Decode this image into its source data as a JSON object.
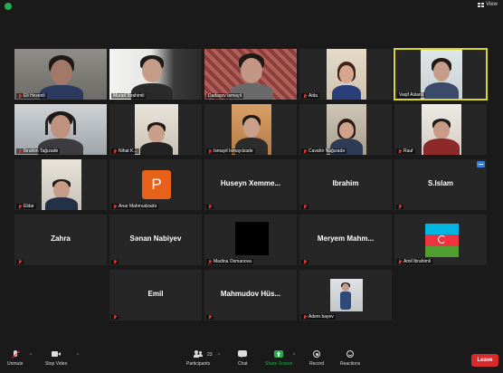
{
  "topbar": {
    "view_label": "View"
  },
  "tiles": [
    {
      "name": "Eli Hasanli",
      "label": "Eli Hesenli",
      "muted": true,
      "kind": "video"
    },
    {
      "name": "Murad Ibrahimli",
      "label": "Murad İbrahimli",
      "muted": false,
      "kind": "video"
    },
    {
      "name": "Dadashov Ismayil",
      "label": "Dadaşov İsmayıl",
      "muted": false,
      "kind": "video"
    },
    {
      "name": "Aida",
      "label": "Aida",
      "muted": true,
      "kind": "video"
    },
    {
      "name": "Vaqif Aslanli",
      "label": "Vaqif Aslanlı",
      "muted": false,
      "kind": "video",
      "active": true
    },
    {
      "name": "Ibrahim Tagizade",
      "label": "İbrahim Tağızade",
      "muted": true,
      "kind": "video"
    },
    {
      "name": "Nihat K",
      "label": "Nihat K...",
      "muted": true,
      "kind": "video"
    },
    {
      "name": "Ismayil Ismayilzade",
      "label": "İsmayil İsmayılzade",
      "muted": true,
      "kind": "video"
    },
    {
      "name": "Cavahir Nagizade",
      "label": "Cavahir Nağızadə",
      "muted": true,
      "kind": "video"
    },
    {
      "name": "Rauf",
      "label": "Rauf",
      "muted": true,
      "kind": "video"
    },
    {
      "name": "Eldar",
      "label": "Eldar",
      "muted": true,
      "kind": "video"
    },
    {
      "name": "Anar Mahmudzada",
      "label": "Anar Mahmudzadə",
      "muted": true,
      "kind": "avatar",
      "initial": "P"
    },
    {
      "name": "Huseyn Xemme",
      "label": "Huseyn   Xemme...",
      "muted": true,
      "kind": "text"
    },
    {
      "name": "Ibrahim",
      "label": "Ibrahim",
      "muted": true,
      "kind": "text"
    },
    {
      "name": "S.Islam",
      "label": "S.Islam",
      "muted": true,
      "kind": "text"
    },
    {
      "name": "Zahra",
      "label": "Zahra",
      "muted": true,
      "kind": "text"
    },
    {
      "name": "Sanan Nabiyev",
      "label": "Sənan Nabiyev",
      "muted": true,
      "kind": "text"
    },
    {
      "name": "Madina Osmanova",
      "label": "Madina Osmanova",
      "muted": true,
      "kind": "black"
    },
    {
      "name": "Meryem Mahm",
      "label": "Meryem   Mahm...",
      "muted": true,
      "kind": "text"
    },
    {
      "name": "Amil Ibrahimli",
      "label": "Amil İbrahimli",
      "muted": true,
      "kind": "flag"
    },
    {
      "name": "Emil",
      "label": "Emil",
      "muted": true,
      "kind": "text"
    },
    {
      "name": "Mahmudov Hus",
      "label": "Mahmudov   Hüs...",
      "muted": true,
      "kind": "text"
    },
    {
      "name": "Adem bayev",
      "label": "Adem bayev",
      "muted": true,
      "kind": "photo"
    }
  ],
  "toolbar": {
    "unmute": "Unmute",
    "stop_video": "Stop Video",
    "participants": "Participants",
    "participants_count": "23",
    "chat": "Chat",
    "share_screen": "Share Screen",
    "record": "Record",
    "reactions": "Reactions",
    "leave": "Leave"
  },
  "colors": {
    "background": "#1a1a1a",
    "tile": "#262626",
    "active_border": "#d8d52b",
    "leave": "#d92b2b",
    "share": "#22b14c",
    "muted": "#e03434"
  }
}
